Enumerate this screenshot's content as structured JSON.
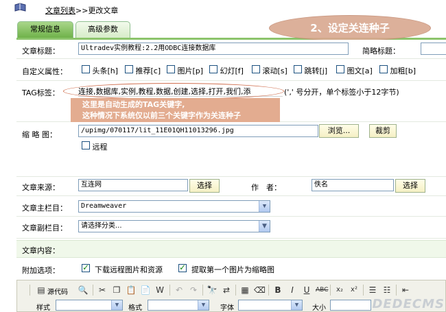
{
  "header": {
    "breadcrumb_link": "文章列表",
    "breadcrumb_sep": ">>",
    "breadcrumb_current": "更改文章"
  },
  "tabs": [
    {
      "label": "常规信息",
      "active": true
    },
    {
      "label": "高级参数",
      "active": false
    }
  ],
  "callout_top": "2、设定关连种子",
  "form": {
    "title_label": "文章标题：",
    "title_value": "Ultradev实例教程:2.2用ODBC连接数据库",
    "short_title_label": "简略标题：",
    "attr_label": "自定义属性：",
    "attrs": [
      "头条[h]",
      "推荐[c]",
      "图片[p]",
      "幻灯[f]",
      "滚动[s]",
      "跳转[j]",
      "图文[a]",
      "加粗[b]"
    ],
    "tag_label": "TAG标签：",
    "tag_value": "连接,数据库,实例,教程,数据,创建,选择,打开,我们,添",
    "tag_hint": "(',' 号分开，单个标签小于12字节)",
    "tag_note_line1": "这里是自动生成的TAG关键字,",
    "tag_note_line2": "这种情况下系统仅以前三个关键字作为关连种子",
    "thumb_label": "缩 略 图：",
    "thumb_value": "/upimg/070117/lit_11E01QH11013296.jpg",
    "browse_label": "浏览...",
    "crop_label": "裁剪",
    "remote_label": "远程",
    "source_label": "文章来源：",
    "source_value": "互连网",
    "source_select": "选择",
    "author_label": "作　者：",
    "author_value": "佚名",
    "author_select": "选择",
    "main_col_label": "文章主栏目：",
    "main_col_value": "Dreamweaver",
    "sub_col_label": "文章副栏目：",
    "sub_col_value": "请选择分类...",
    "content_label": "文章内容：",
    "extra_label": "附加选项：",
    "extra_opt1": "下载远程图片和资源",
    "extra_opt2": "提取第一个图片为缩略图"
  },
  "editor": {
    "source_label": "源代码",
    "style_label": "样式",
    "format_label": "格式",
    "font_label": "字体",
    "size_label": "大小"
  },
  "watermark": "DEDECMS"
}
